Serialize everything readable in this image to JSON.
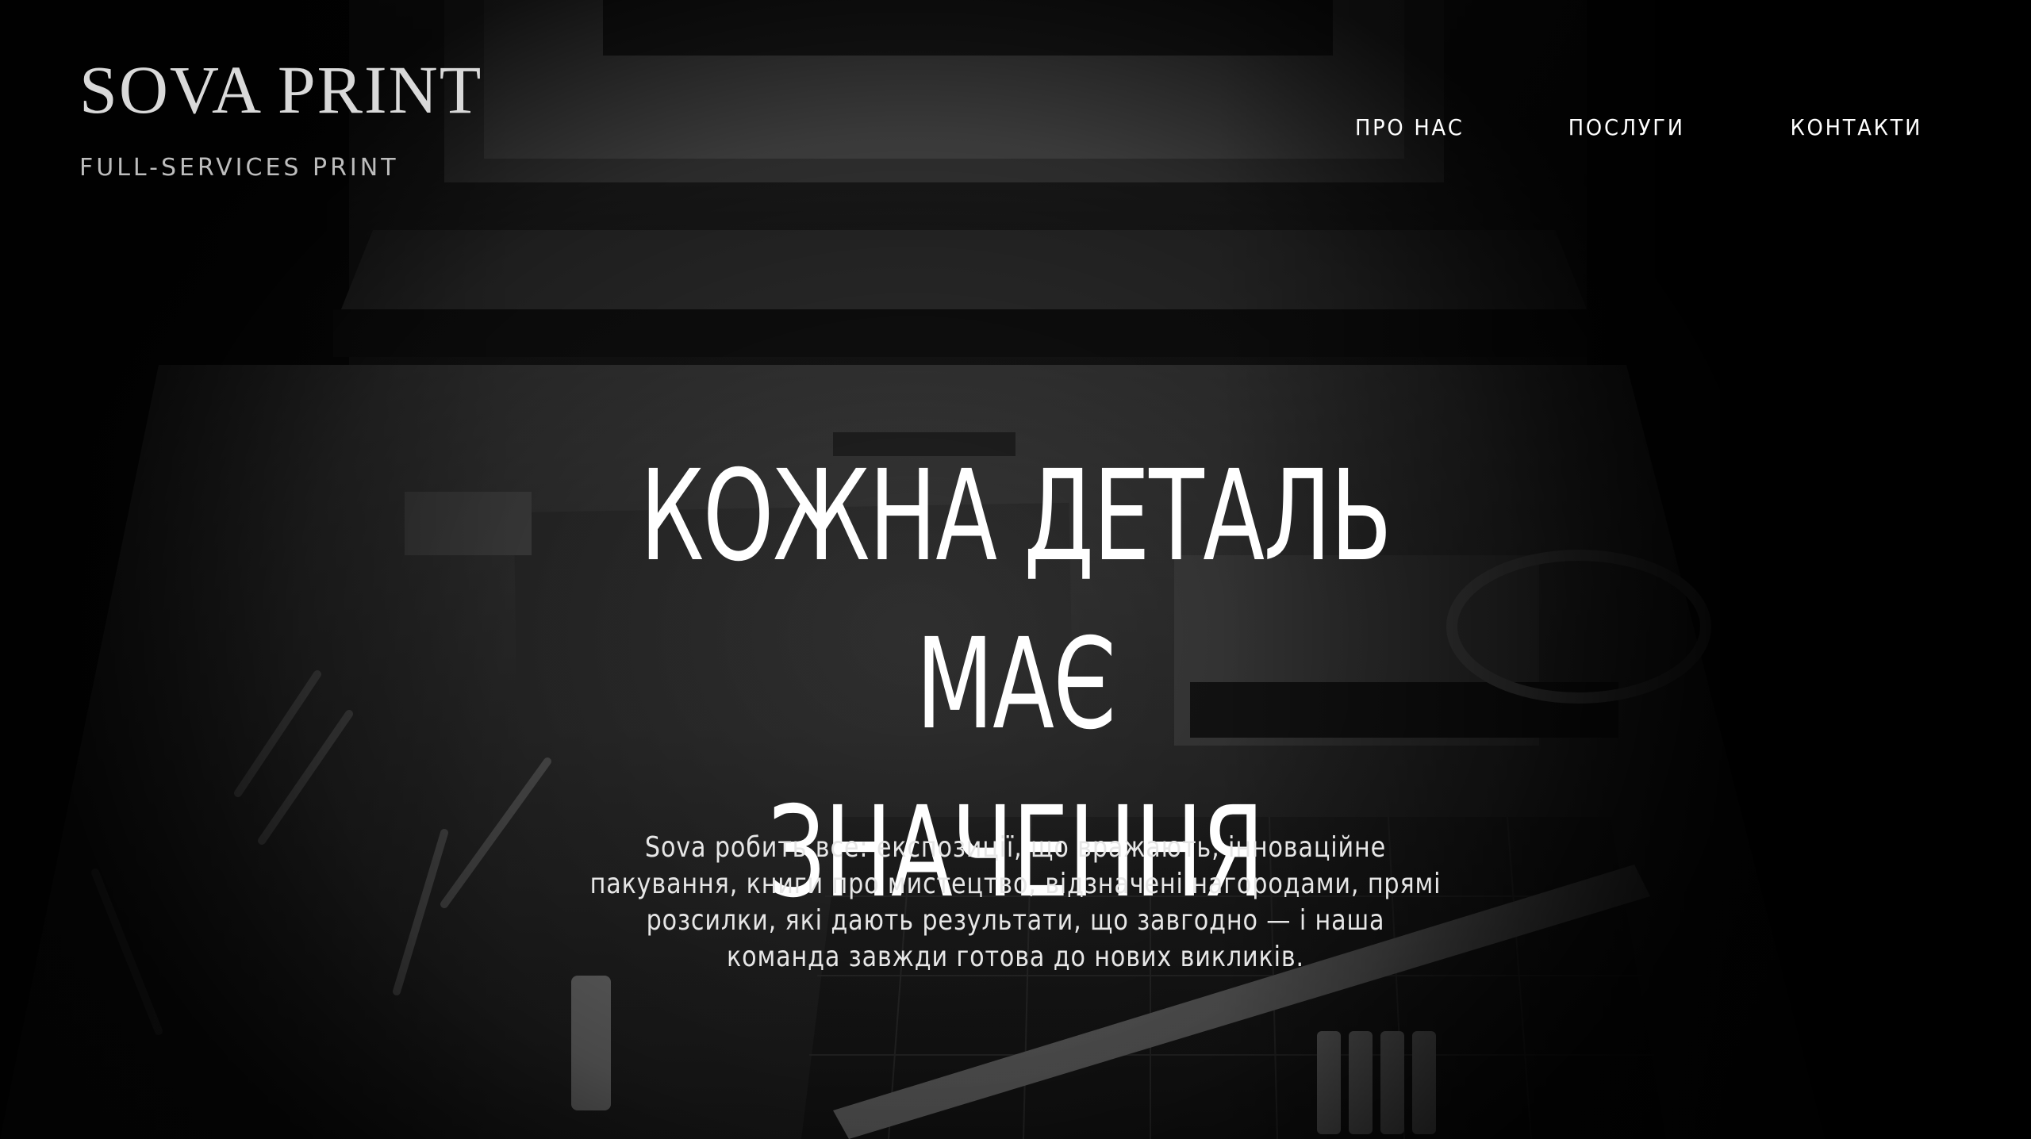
{
  "brand": {
    "name": "SOVA PRINT",
    "tagline": "FULL-SERVICES PRINT"
  },
  "nav": {
    "items": [
      {
        "label": "ПРО НАС"
      },
      {
        "label": "ПОСЛУГИ"
      },
      {
        "label": "КОНТАКТИ"
      }
    ]
  },
  "hero": {
    "title_line1": "КОЖНА ДЕТАЛЬ МАЄ",
    "title_line2": "ЗНАЧЕННЯ",
    "description": "Sova робить все: експозиції, що вражають, інноваційне пакування, книги про мистецтво, відзначені нагородами, прямі розсилки, які дають результати, що завгодно — і наша команда завжди готова до нових викликів."
  },
  "background": {
    "image": "workshop-tools-photo",
    "tone": "#0b0b0b"
  }
}
